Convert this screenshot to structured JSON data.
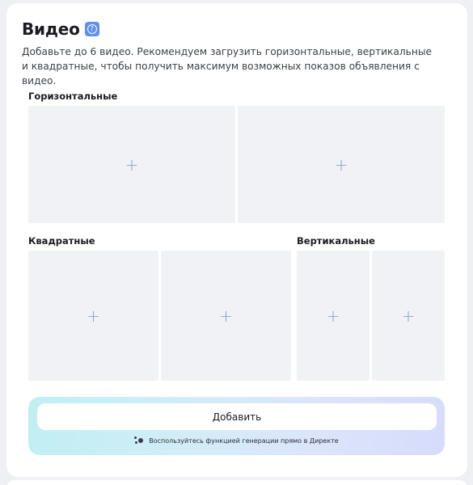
{
  "video": {
    "title": "Видео",
    "help_icon": "question-icon",
    "description_line1": "Добавьте до 6 видео. Рекомендуем загрузить горизонтальные, вертикальные",
    "description_line2": "и квадратные, чтобы получить максимум возможных показов объявления с видео."
  },
  "sections": {
    "horizontal_label": "Горизонтальные",
    "square_label": "Квадратные",
    "vertical_label": "Вертикальные"
  },
  "slot_symbol": "+",
  "add_block": {
    "button_label": "Добавить",
    "hint_icon": "sparkle-icon",
    "hint_text": "Воспользуйтесь функцией генерации прямо в Директе"
  },
  "colors": {
    "slot_bg": "#f1f2f5",
    "plus": "#8f9fc9",
    "help_icon_bg": "#5e8ff2",
    "gradient_start": "#bfeff3",
    "gradient_end": "#d6dcfa"
  }
}
